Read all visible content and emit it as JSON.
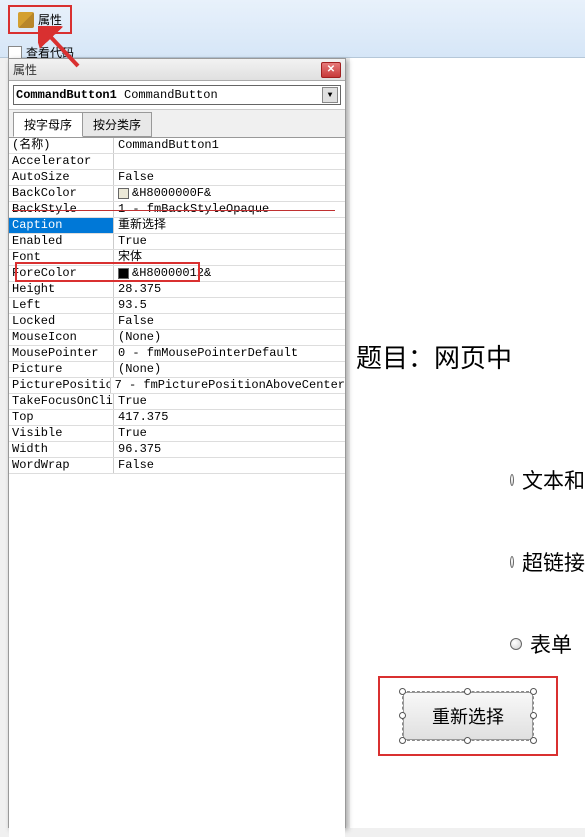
{
  "ribbon": {
    "properties_label": "属性",
    "view_code_label": "查看代码"
  },
  "panel": {
    "title": "属性",
    "object_bold": "CommandButton1",
    "object_type": "CommandButton",
    "tabs": {
      "alpha": "按字母序",
      "category": "按分类序"
    },
    "props": [
      {
        "name": "(名称)",
        "value": "CommandButton1"
      },
      {
        "name": "Accelerator",
        "value": ""
      },
      {
        "name": "AutoSize",
        "value": "False"
      },
      {
        "name": "BackColor",
        "value": "&H8000000F&",
        "swatch": "#ece9d8"
      },
      {
        "name": "BackStyle",
        "value": "1 - fmBackStyleOpaque",
        "strike": true
      },
      {
        "name": "Caption",
        "value": "重新选择",
        "selected": true
      },
      {
        "name": "Enabled",
        "value": "True"
      },
      {
        "name": "Font",
        "value": "宋体"
      },
      {
        "name": "ForeColor",
        "value": "&H80000012&",
        "swatch": "#000000"
      },
      {
        "name": "Height",
        "value": "28.375"
      },
      {
        "name": "Left",
        "value": "93.5"
      },
      {
        "name": "Locked",
        "value": "False"
      },
      {
        "name": "MouseIcon",
        "value": "(None)"
      },
      {
        "name": "MousePointer",
        "value": "0 - fmMousePointerDefault"
      },
      {
        "name": "Picture",
        "value": "(None)"
      },
      {
        "name": "PicturePosition",
        "value": "7 - fmPicturePositionAboveCenter"
      },
      {
        "name": "TakeFocusOnClick",
        "value": "True"
      },
      {
        "name": "Top",
        "value": "417.375"
      },
      {
        "name": "Visible",
        "value": "True"
      },
      {
        "name": "Width",
        "value": "96.375"
      },
      {
        "name": "WordWrap",
        "value": "False"
      }
    ]
  },
  "document": {
    "heading": "题目：网页中",
    "options": [
      "文本和",
      "超链接",
      "表单"
    ],
    "button_label": "重新选择"
  }
}
